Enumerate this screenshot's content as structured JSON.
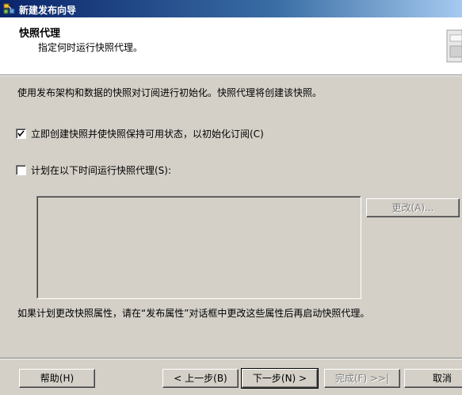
{
  "window": {
    "title": "新建发布向导"
  },
  "header": {
    "title": "快照代理",
    "subtitle": "指定何时运行快照代理。"
  },
  "main": {
    "description": "使用发布架构和数据的快照对订阅进行初始化。快照代理将创建该快照。",
    "option_create_now": {
      "label": "立即创建快照并使快照保持可用状态，以初始化订阅(C)",
      "checked": true
    },
    "option_schedule": {
      "label": "计划在以下时间运行快照代理(S):",
      "checked": false
    },
    "change_button": "更改(A)...",
    "footnote": "如果计划更改快照属性，请在“发布属性”对话框中更改这些属性后再启动快照代理。"
  },
  "buttons": {
    "help": "帮助(H)",
    "back": "< 上一步(B)",
    "next": "下一步(N) >",
    "finish": "完成(F) >>|",
    "cancel": "取消"
  }
}
